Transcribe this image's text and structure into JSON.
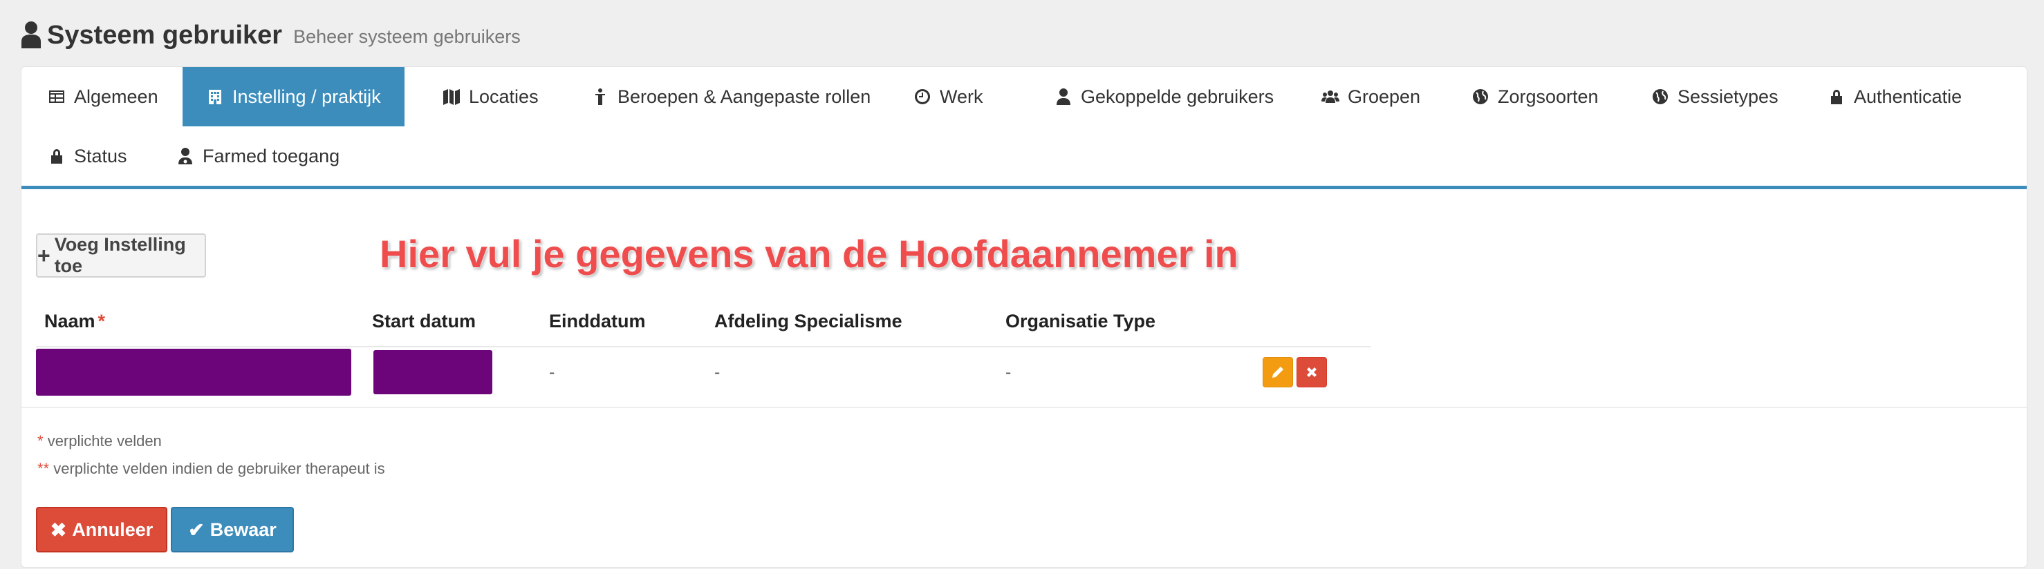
{
  "header": {
    "title": "Systeem gebruiker",
    "subtitle": "Beheer systeem gebruikers"
  },
  "tabs": [
    {
      "label": "Algemeen",
      "icon": "table-icon",
      "active": false
    },
    {
      "label": "Instelling / praktijk",
      "icon": "hospital-icon",
      "active": true
    },
    {
      "label": "Locaties",
      "icon": "map-icon",
      "active": false
    },
    {
      "label": "Beroepen & Aangepaste rollen",
      "icon": "person-icon",
      "active": false
    },
    {
      "label": "Werk",
      "icon": "clock-icon",
      "active": false
    },
    {
      "label": "Gekoppelde gebruikers",
      "icon": "user-icon",
      "active": false
    },
    {
      "label": "Groepen",
      "icon": "users-icon",
      "active": false
    },
    {
      "label": "Zorgsoorten",
      "icon": "globe-icon",
      "active": false
    },
    {
      "label": "Sessietypes",
      "icon": "globe-icon",
      "active": false
    },
    {
      "label": "Authenticatie",
      "icon": "lock-icon",
      "active": false
    },
    {
      "label": "Status",
      "icon": "lock-icon",
      "active": false
    },
    {
      "label": "Farmed toegang",
      "icon": "user-md-icon",
      "active": false
    }
  ],
  "add_button": {
    "label": "Voeg Instelling toe"
  },
  "annotation": "Hier vul je gegevens van de Hoofdaannemer in",
  "table": {
    "columns": [
      "Naam",
      "Start datum",
      "Einddatum",
      "Afdeling Specialisme",
      "Organisatie Type"
    ],
    "required_marker": "*",
    "rows": [
      {
        "naam": "",
        "start": "",
        "eind": "-",
        "afdeling": "-",
        "organisatie": "-"
      }
    ]
  },
  "notes": {
    "req1_marker": "*",
    "req1_text": "verplichte velden",
    "req2_marker": "**",
    "req2_text": "verplichte velden indien de gebruiker therapeut is"
  },
  "buttons": {
    "cancel": "Annuleer",
    "save": "Bewaar"
  },
  "colors": {
    "primary": "#3c8dbc",
    "danger": "#dd4b39",
    "warning": "#f39c12",
    "redaction": "#6b0579",
    "annotation": "#ef4d4d"
  }
}
